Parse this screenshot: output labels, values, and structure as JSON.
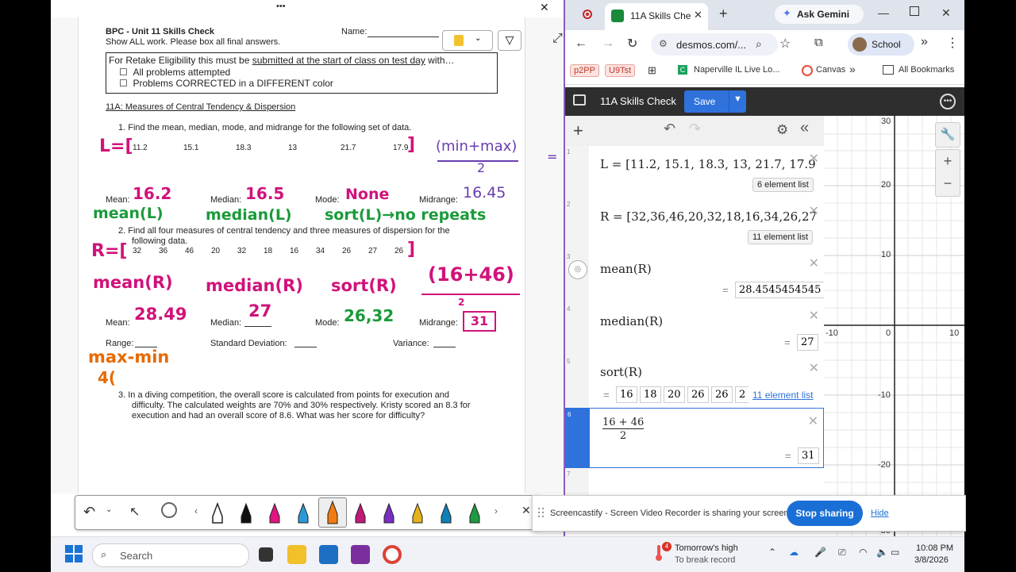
{
  "onenote": {
    "toolbar_dots": "•••",
    "close_glyph": "✕",
    "doc": {
      "header_title": "BPC - Unit 11 Skills Check",
      "header_sub": "Show ALL work.  Please box all final answers.",
      "name_label": "Name:",
      "retake_line_pre": "For Retake Eligibility this must be ",
      "retake_line_u": "submitted at the start of class on test day",
      "retake_line_post": " with…",
      "retake_item1": "All problems attempted",
      "retake_item2": "Problems CORRECTED in a DIFFERENT color",
      "section_title": "11A: Measures of Central Tendency & Dispersion",
      "q1": "1.    Find the mean, median, mode, and midrange for the following set of data.",
      "q1_data": [
        "11.2",
        "15.1",
        "18.3",
        "13",
        "21.7",
        "17.9"
      ],
      "q1_labels": {
        "mean": "Mean:",
        "median": "Median:",
        "mode": "Mode:",
        "midrange": "Midrange:"
      },
      "q2_line1": "2.    Find all four measures of central tendency and three measures of dispersion for the",
      "q2_line2": "following data.",
      "q2_data": [
        "32",
        "36",
        "46",
        "20",
        "32",
        "18",
        "16",
        "34",
        "26",
        "27",
        "26"
      ],
      "q2_labels": {
        "mean": "Mean:",
        "median": "Median:",
        "mode": "Mode:",
        "midrange": "Midrange:",
        "range": "Range:",
        "sd": "Standard Deviation:",
        "variance": "Variance:"
      },
      "q3_line1": "3.    In a diving competition, the overall score is calculated from points for execution and",
      "q3_line2": "difficulty. The calculated weights are 70% and 30% respectively. Kristy scored an 8.3 for",
      "q3_line3": "execution and had an overall score of 8.6. What was her score for difficulty?"
    },
    "handwriting": {
      "l_eq": "L=[",
      "min_max": "(min+max)",
      "over2": "2",
      "eq_tail": "=",
      "mean_ans1": "16.2",
      "median_ans1": "16.5",
      "mode_ans1": "None",
      "midrange_ans1": "16.45",
      "mean_fn1": "mean(L)",
      "median_fn1": "median(L)",
      "sort_fn1": "sort(L)→no repeats",
      "r_eq": "R=[",
      "mean_fn2": "mean(R)",
      "median_fn2": "median(R)",
      "sort_fn2": "sort(R)",
      "sum_frac": "(16+46)",
      "mean_ans2": "28.49",
      "median_ans2": "27",
      "mode_ans2": "26,32",
      "midrange_ans2": "31",
      "range_formula": "max-min",
      "range_partial": "4("
    }
  },
  "chrome": {
    "tab_title": "11A Skills Che",
    "new_tab": "+",
    "gemini": "Ask Gemini",
    "url": "desmos.com/...",
    "profile": "School",
    "bookmarks": [
      "p2PP",
      "U9Tst",
      "Naperville IL Live Lo...",
      "Canvas"
    ],
    "all_bookmarks": "All Bookmarks"
  },
  "desmos": {
    "title": "11A Skills Check",
    "save": "Save",
    "expressions": [
      {
        "idx": "1",
        "latex": "L = [11.2, 15.1, 18.3, 13, 21.7, 17.9",
        "badge": "6 element list"
      },
      {
        "idx": "2",
        "latex": "R = [32,36,46,20,32,18,16,34,26,27",
        "badge": "11 element list"
      },
      {
        "idx": "3",
        "latex": "mean(R)",
        "result": "28.4545454545"
      },
      {
        "idx": "4",
        "latex": "median(R)",
        "result": "27"
      },
      {
        "idx": "5",
        "latex": "sort(R)",
        "list": [
          "16",
          "18",
          "20",
          "26",
          "26",
          "2"
        ],
        "link": "11 element list"
      },
      {
        "idx": "6",
        "num": "16 + 46",
        "den": "2",
        "result": "31"
      },
      {
        "idx": "7"
      }
    ],
    "graph_y_labels": [
      "30",
      "20",
      "10",
      "0",
      "-10",
      "-20",
      "-30"
    ],
    "graph_x_labels": [
      "-10",
      "0",
      "10"
    ]
  },
  "screencastify": {
    "message": "Screencastify - Screen Video Recorder is sharing your screen.",
    "stop": "Stop sharing",
    "hide": "Hide"
  },
  "taskbar": {
    "search_placeholder": "Search",
    "weather_title": "Tomorrow's high",
    "weather_sub": "To break record",
    "weather_badge": "4",
    "time": "10:08 PM",
    "date": "3/8/2026"
  }
}
